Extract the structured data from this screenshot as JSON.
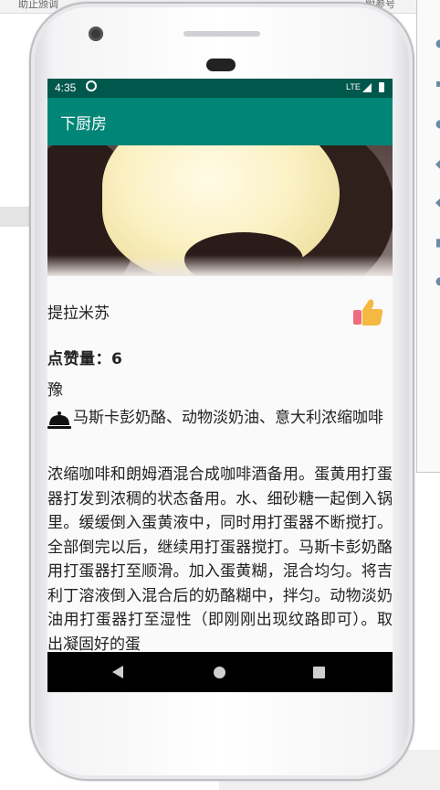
{
  "background": {
    "top_left_text": "助止颁调",
    "top_right_text": "附参号"
  },
  "status_bar": {
    "time": "4:35",
    "network": "LTE"
  },
  "app_bar": {
    "title": "下厨房"
  },
  "recipe": {
    "name": "提拉米苏",
    "likes_text": "点赞量：6",
    "author": "豫",
    "ingredients": "马斯卡彭奶酪、动物淡奶油、意大利浓缩咖啡",
    "steps": "浓缩咖啡和朗姆酒混合成咖啡酒备用。蛋黄用打蛋器打发到浓稠的状态备用。水、细砂糖一起倒入锅里。缓缓倒入蛋黄液中，同时用打蛋器不断搅打。全部倒完以后，继续用打蛋器搅打。马斯卡彭奶酪用打蛋器打至顺滑。加入蛋黄糊，混合均匀。将吉利丁溶液倒入混合后的奶酪糊中，拌匀。动物淡奶油用打蛋器打至湿性（即刚刚出现纹路即可）。取出凝固好的蛋"
  },
  "icons": {
    "like": "thumbs-up-icon",
    "dish": "cloche-icon",
    "nav_back": "back-icon",
    "nav_home": "home-icon",
    "nav_recents": "recents-icon"
  },
  "colors": {
    "status_bar": "#00574b",
    "app_bar": "#008577",
    "screen_bg": "#fafafa"
  }
}
